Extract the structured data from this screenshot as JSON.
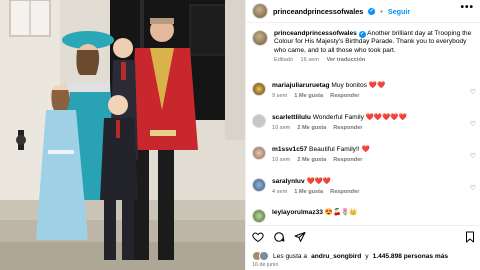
{
  "header": {
    "username": "princeandprincessofwales",
    "verified_icon": "verified-badge-icon",
    "separator": "•",
    "follow_label": "Seguir",
    "more_label": "•••"
  },
  "caption": {
    "username": "princeandprincessofwales",
    "text": "Another brilliant day at Trooping the Colour for His Majesty's Birthday Parade. Thank you to everybody who came, and to all those who took part.",
    "edited": "Editado",
    "time": "16 sem",
    "translate": "Ver traducción"
  },
  "comments": [
    {
      "username": "mariajuliaruruetag",
      "text": "Muy bonitos",
      "emoji": "❤️❤️",
      "time": "9 sem",
      "likes": "1 Me gusta",
      "reply": "Responder"
    },
    {
      "username": "scarlettlilulu",
      "text": "Wonderful Family",
      "emoji": "❤️❤️❤️❤️❤️",
      "time": "10 sem",
      "likes": "2 Me gusta",
      "reply": "Responder"
    },
    {
      "username": "m1ssv1c57",
      "text": "Beautiful Family!!",
      "emoji": "❤️",
      "time": "10 sem",
      "likes": "2 Me gusta",
      "reply": "Responder"
    },
    {
      "username": "saralynluv",
      "text": "",
      "emoji": "❤️❤️❤️",
      "time": "4 sem",
      "likes": "1 Me gusta",
      "reply": "Responder"
    },
    {
      "username": "leylayorulmaz33",
      "text": "",
      "emoji": "😍🍒🌷👑",
      "time": "",
      "likes": "",
      "reply": ""
    }
  ],
  "actions": {
    "like_icon": "heart-icon",
    "comment_icon": "comment-icon",
    "share_icon": "share-icon",
    "save_icon": "bookmark-icon"
  },
  "likes_summary": {
    "prefix": "Les gusta a",
    "user": "andru_songbird",
    "middle": "y",
    "count": "1.445.898 personas más"
  },
  "date": "16 de junio"
}
